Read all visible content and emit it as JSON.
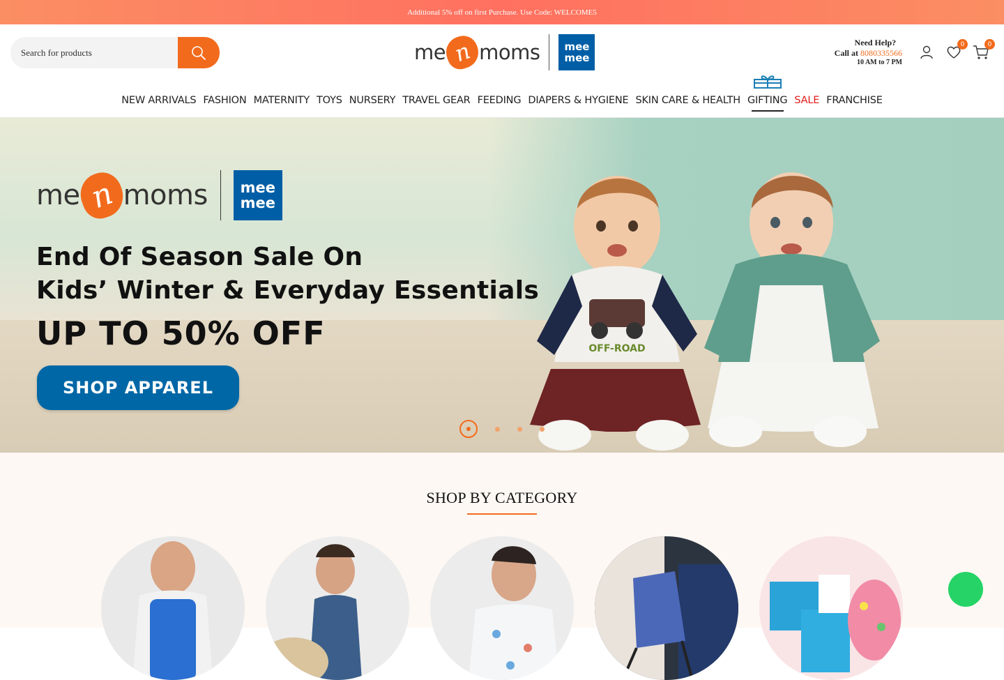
{
  "announcement": "Additional 5% off on first Purchase. Use Code: WELCOME5",
  "search": {
    "placeholder": "Search for products"
  },
  "logo": {
    "left": "me",
    "n": "n",
    "right": "moms",
    "badge_top": "mee",
    "badge_bottom": "mee"
  },
  "help": {
    "title": "Need Help?",
    "call_label": "Call at ",
    "phone": "8080335566",
    "hours": "10 AM to 7 PM"
  },
  "wishlist_count": "0",
  "cart_count": "0",
  "nav": [
    "NEW ARRIVALS",
    "FASHION",
    "MATERNITY",
    "TOYS",
    "NURSERY",
    "TRAVEL GEAR",
    "FEEDING",
    "DIAPERS & HYGIENE",
    "SKIN CARE & HEALTH",
    "GIFTING",
    "SALE",
    "FRANCHISE"
  ],
  "hero": {
    "headline_line1": "End Of Season Sale On",
    "headline_line2": "Kids’ Winter & Everyday Essentials",
    "offer": "UP TO 50% OFF",
    "cta": "SHOP APPAREL",
    "shirt_text": "OFF-ROAD",
    "slides": 4,
    "active_slide": 1
  },
  "categories": {
    "title": "SHOP BY CATEGORY"
  },
  "colors": {
    "accent": "#f26b1d",
    "brand_blue": "#005ea6",
    "sale": "#e21b1b",
    "announcement": "#ff7060",
    "chat": "#25d366"
  }
}
